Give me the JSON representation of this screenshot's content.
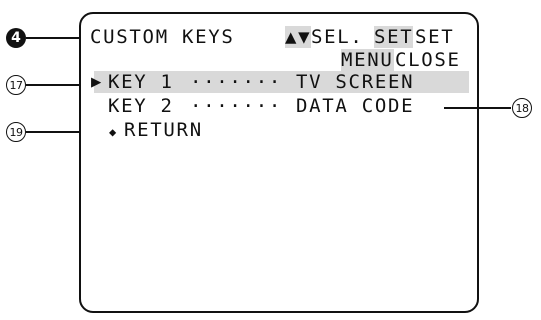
{
  "callouts": {
    "c4": "4",
    "c17": "17",
    "c18": "18",
    "c19": "19"
  },
  "menu": {
    "title": "CUSTOM KEYS",
    "hint_arrows": "▲▼",
    "hint_sel": "SEL.",
    "hint_set_key": "SET",
    "hint_set": "SET",
    "hint_menu_key": "MENU",
    "hint_close": "CLOSE",
    "items": [
      {
        "cursor": "▶",
        "label": "KEY 1",
        "dots": "·······",
        "value": "TV SCREEN"
      },
      {
        "cursor": "",
        "label": "KEY 2",
        "dots": "·······",
        "value": "DATA CODE"
      }
    ],
    "return_icon": "◆",
    "return_label": "RETURN"
  },
  "colors": {
    "highlight": "#d9d9d9",
    "ink": "#111111"
  }
}
